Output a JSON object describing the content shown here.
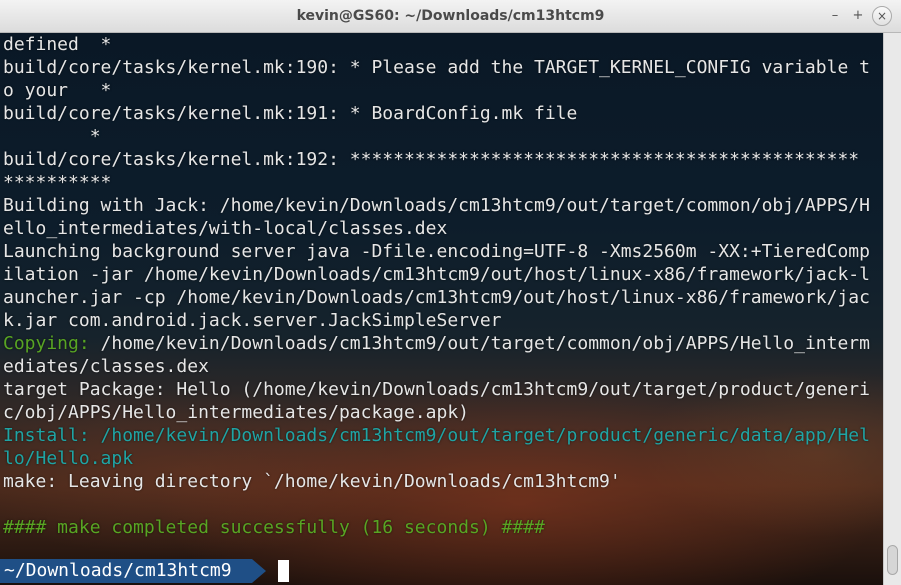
{
  "window": {
    "title": "kevin@GS60: ~/Downloads/cm13htcm9",
    "buttons": {
      "minimize": "–",
      "maximize": "+",
      "close": "×"
    }
  },
  "terminal": {
    "lines": [
      {
        "text": "defined  *",
        "color": "default"
      },
      {
        "text": "build/core/tasks/kernel.mk:190: * Please add the TARGET_KERNEL_CONFIG variable t",
        "color": "default"
      },
      {
        "text": "o your   *",
        "color": "default"
      },
      {
        "text": "build/core/tasks/kernel.mk:191: * BoardConfig.mk file",
        "color": "default"
      },
      {
        "text": "        *",
        "color": "default"
      },
      {
        "text": "build/core/tasks/kernel.mk:192: ***********************************************",
        "color": "default"
      },
      {
        "text": "**********",
        "color": "default"
      },
      {
        "text": "Building with Jack: /home/kevin/Downloads/cm13htcm9/out/target/common/obj/APPS/H",
        "color": "default"
      },
      {
        "text": "ello_intermediates/with-local/classes.dex",
        "color": "default"
      },
      {
        "text": "Launching background server java -Dfile.encoding=UTF-8 -Xms2560m -XX:+TieredComp",
        "color": "default"
      },
      {
        "text": "ilation -jar /home/kevin/Downloads/cm13htcm9/out/host/linux-x86/framework/jack-l",
        "color": "default"
      },
      {
        "text": "auncher.jar -cp /home/kevin/Downloads/cm13htcm9/out/host/linux-x86/framework/jac",
        "color": "default"
      },
      {
        "text": "k.jar com.android.jack.server.JackSimpleServer",
        "color": "default"
      },
      {
        "segments": [
          {
            "text": "Copying:",
            "color": "green"
          },
          {
            "text": " /home/kevin/Downloads/cm13htcm9/out/target/common/obj/APPS/Hello_interm",
            "color": "default"
          }
        ]
      },
      {
        "text": "ediates/classes.dex",
        "color": "default"
      },
      {
        "text": "target Package: Hello (/home/kevin/Downloads/cm13htcm9/out/target/product/generi",
        "color": "default"
      },
      {
        "text": "c/obj/APPS/Hello_intermediates/package.apk)",
        "color": "default"
      },
      {
        "text": "Install: /home/kevin/Downloads/cm13htcm9/out/target/product/generic/data/app/Hel",
        "color": "cyan"
      },
      {
        "text": "lo/Hello.apk",
        "color": "cyan"
      },
      {
        "text": "make: Leaving directory `/home/kevin/Downloads/cm13htcm9'",
        "color": "default"
      },
      {
        "text": "",
        "color": "default"
      },
      {
        "text": "#### make completed successfully (16 seconds) ####",
        "color": "green"
      }
    ],
    "prompt": {
      "path": "~/Downloads/cm13htcm9"
    },
    "colors": {
      "default": "#e6e6e6",
      "cyan": "#1fa4a4",
      "green": "#58a523",
      "prompt_bg": "#1f4f86"
    }
  }
}
